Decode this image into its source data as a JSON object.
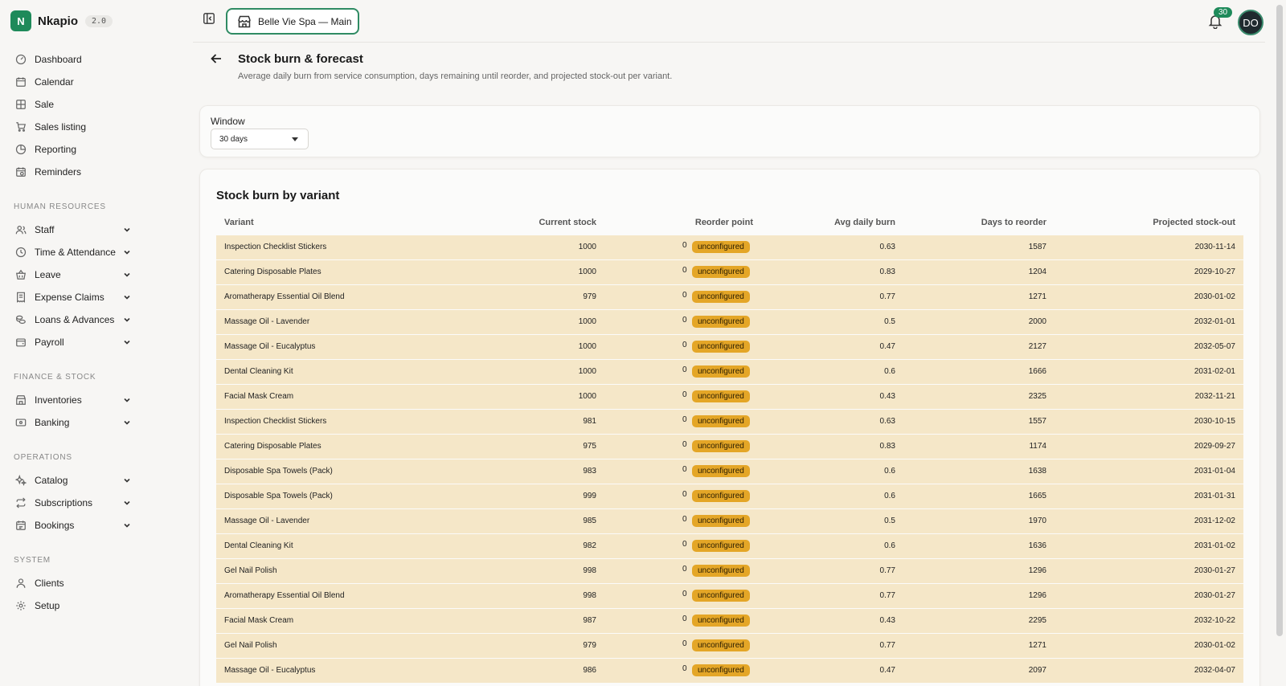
{
  "brand": {
    "logo_letter": "N",
    "name": "Nkapio",
    "version": "2.0"
  },
  "sidebar": {
    "main": [
      {
        "label": "Dashboard",
        "icon": "gauge-icon"
      },
      {
        "label": "Calendar",
        "icon": "calendar-icon"
      },
      {
        "label": "Sale",
        "icon": "grid-icon"
      },
      {
        "label": "Sales listing",
        "icon": "cart-icon"
      },
      {
        "label": "Reporting",
        "icon": "pie-icon"
      },
      {
        "label": "Reminders",
        "icon": "calendar-clock-icon"
      }
    ],
    "sections": [
      {
        "title": "HUMAN RESOURCES",
        "items": [
          {
            "label": "Staff",
            "icon": "users-icon"
          },
          {
            "label": "Time & Attendance",
            "icon": "clock-icon"
          },
          {
            "label": "Leave",
            "icon": "basket-icon"
          },
          {
            "label": "Expense Claims",
            "icon": "receipt-icon"
          },
          {
            "label": "Loans & Advances",
            "icon": "coins-icon"
          },
          {
            "label": "Payroll",
            "icon": "wallet-icon"
          }
        ]
      },
      {
        "title": "FINANCE & STOCK",
        "items": [
          {
            "label": "Inventories",
            "icon": "store-icon"
          },
          {
            "label": "Banking",
            "icon": "bank-card-icon"
          }
        ]
      },
      {
        "title": "OPERATIONS",
        "items": [
          {
            "label": "Catalog",
            "icon": "sparkle-icon"
          },
          {
            "label": "Subscriptions",
            "icon": "repeat-icon"
          },
          {
            "label": "Bookings",
            "icon": "calendar-check-icon"
          }
        ]
      },
      {
        "title": "SYSTEM",
        "items": [
          {
            "label": "Clients",
            "icon": "user-icon"
          },
          {
            "label": "Setup",
            "icon": "gear-icon"
          }
        ]
      }
    ]
  },
  "topbar": {
    "location": "Belle Vie Spa — Main",
    "notifications": "30",
    "avatar_initials": "DO"
  },
  "page": {
    "title": "Stock burn & forecast",
    "description": "Average daily burn from service consumption, days remaining until reorder, and projected stock-out per variant."
  },
  "filter": {
    "label": "Window",
    "value": "30 days"
  },
  "table": {
    "title": "Stock burn by variant",
    "columns": [
      "Variant",
      "Current stock",
      "Reorder point",
      "Avg daily burn",
      "Days to reorder",
      "Projected stock-out"
    ],
    "rows": [
      {
        "variant": "Inspection Checklist Stickers",
        "stock": "1000",
        "reorder": "0",
        "status": "unconfigured",
        "burn": "0.63",
        "days": "1587",
        "proj": "2030-11-14"
      },
      {
        "variant": "Catering Disposable Plates",
        "stock": "1000",
        "reorder": "0",
        "status": "unconfigured",
        "burn": "0.83",
        "days": "1204",
        "proj": "2029-10-27"
      },
      {
        "variant": "Aromatherapy Essential Oil Blend",
        "stock": "979",
        "reorder": "0",
        "status": "unconfigured",
        "burn": "0.77",
        "days": "1271",
        "proj": "2030-01-02"
      },
      {
        "variant": "Massage Oil - Lavender",
        "stock": "1000",
        "reorder": "0",
        "status": "unconfigured",
        "burn": "0.5",
        "days": "2000",
        "proj": "2032-01-01"
      },
      {
        "variant": "Massage Oil - Eucalyptus",
        "stock": "1000",
        "reorder": "0",
        "status": "unconfigured",
        "burn": "0.47",
        "days": "2127",
        "proj": "2032-05-07"
      },
      {
        "variant": "Dental Cleaning Kit",
        "stock": "1000",
        "reorder": "0",
        "status": "unconfigured",
        "burn": "0.6",
        "days": "1666",
        "proj": "2031-02-01"
      },
      {
        "variant": "Facial Mask Cream",
        "stock": "1000",
        "reorder": "0",
        "status": "unconfigured",
        "burn": "0.43",
        "days": "2325",
        "proj": "2032-11-21"
      },
      {
        "variant": "Inspection Checklist Stickers",
        "stock": "981",
        "reorder": "0",
        "status": "unconfigured",
        "burn": "0.63",
        "days": "1557",
        "proj": "2030-10-15"
      },
      {
        "variant": "Catering Disposable Plates",
        "stock": "975",
        "reorder": "0",
        "status": "unconfigured",
        "burn": "0.83",
        "days": "1174",
        "proj": "2029-09-27"
      },
      {
        "variant": "Disposable Spa Towels (Pack)",
        "stock": "983",
        "reorder": "0",
        "status": "unconfigured",
        "burn": "0.6",
        "days": "1638",
        "proj": "2031-01-04"
      },
      {
        "variant": "Disposable Spa Towels (Pack)",
        "stock": "999",
        "reorder": "0",
        "status": "unconfigured",
        "burn": "0.6",
        "days": "1665",
        "proj": "2031-01-31"
      },
      {
        "variant": "Massage Oil - Lavender",
        "stock": "985",
        "reorder": "0",
        "status": "unconfigured",
        "burn": "0.5",
        "days": "1970",
        "proj": "2031-12-02"
      },
      {
        "variant": "Dental Cleaning Kit",
        "stock": "982",
        "reorder": "0",
        "status": "unconfigured",
        "burn": "0.6",
        "days": "1636",
        "proj": "2031-01-02"
      },
      {
        "variant": "Gel Nail Polish",
        "stock": "998",
        "reorder": "0",
        "status": "unconfigured",
        "burn": "0.77",
        "days": "1296",
        "proj": "2030-01-27"
      },
      {
        "variant": "Aromatherapy Essential Oil Blend",
        "stock": "998",
        "reorder": "0",
        "status": "unconfigured",
        "burn": "0.77",
        "days": "1296",
        "proj": "2030-01-27"
      },
      {
        "variant": "Facial Mask Cream",
        "stock": "987",
        "reorder": "0",
        "status": "unconfigured",
        "burn": "0.43",
        "days": "2295",
        "proj": "2032-10-22"
      },
      {
        "variant": "Gel Nail Polish",
        "stock": "979",
        "reorder": "0",
        "status": "unconfigured",
        "burn": "0.77",
        "days": "1271",
        "proj": "2030-01-02"
      },
      {
        "variant": "Massage Oil - Eucalyptus",
        "stock": "986",
        "reorder": "0",
        "status": "unconfigured",
        "burn": "0.47",
        "days": "2097",
        "proj": "2032-04-07"
      }
    ]
  },
  "colors": {
    "accent": "#1e8a5a",
    "row_bg": "#f5e7c8",
    "badge_bg": "#e4a627"
  }
}
